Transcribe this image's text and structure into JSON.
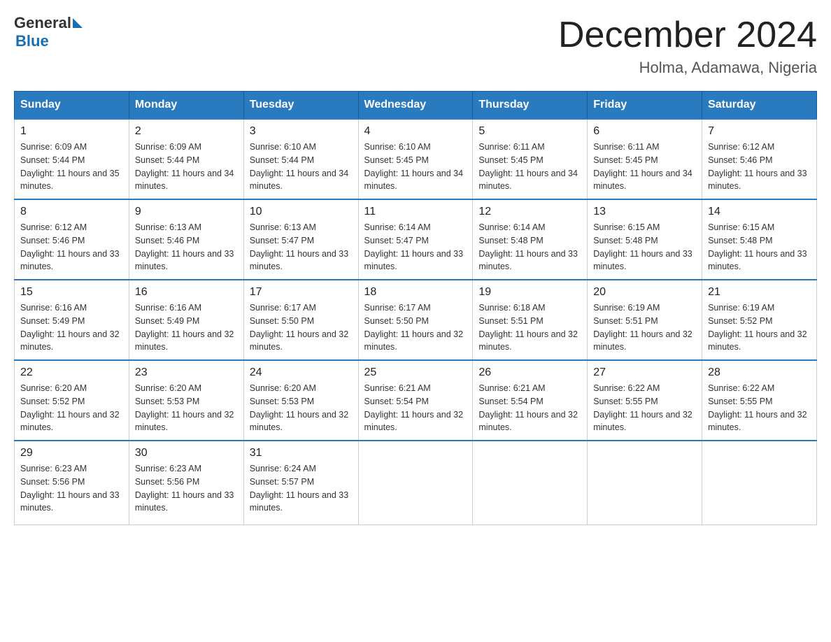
{
  "header": {
    "logo_text1": "General",
    "logo_text2": "Blue",
    "month_title": "December 2024",
    "location": "Holma, Adamawa, Nigeria"
  },
  "days_of_week": [
    "Sunday",
    "Monday",
    "Tuesday",
    "Wednesday",
    "Thursday",
    "Friday",
    "Saturday"
  ],
  "weeks": [
    [
      {
        "day": "1",
        "sunrise": "6:09 AM",
        "sunset": "5:44 PM",
        "daylight": "11 hours and 35 minutes."
      },
      {
        "day": "2",
        "sunrise": "6:09 AM",
        "sunset": "5:44 PM",
        "daylight": "11 hours and 34 minutes."
      },
      {
        "day": "3",
        "sunrise": "6:10 AM",
        "sunset": "5:44 PM",
        "daylight": "11 hours and 34 minutes."
      },
      {
        "day": "4",
        "sunrise": "6:10 AM",
        "sunset": "5:45 PM",
        "daylight": "11 hours and 34 minutes."
      },
      {
        "day": "5",
        "sunrise": "6:11 AM",
        "sunset": "5:45 PM",
        "daylight": "11 hours and 34 minutes."
      },
      {
        "day": "6",
        "sunrise": "6:11 AM",
        "sunset": "5:45 PM",
        "daylight": "11 hours and 34 minutes."
      },
      {
        "day": "7",
        "sunrise": "6:12 AM",
        "sunset": "5:46 PM",
        "daylight": "11 hours and 33 minutes."
      }
    ],
    [
      {
        "day": "8",
        "sunrise": "6:12 AM",
        "sunset": "5:46 PM",
        "daylight": "11 hours and 33 minutes."
      },
      {
        "day": "9",
        "sunrise": "6:13 AM",
        "sunset": "5:46 PM",
        "daylight": "11 hours and 33 minutes."
      },
      {
        "day": "10",
        "sunrise": "6:13 AM",
        "sunset": "5:47 PM",
        "daylight": "11 hours and 33 minutes."
      },
      {
        "day": "11",
        "sunrise": "6:14 AM",
        "sunset": "5:47 PM",
        "daylight": "11 hours and 33 minutes."
      },
      {
        "day": "12",
        "sunrise": "6:14 AM",
        "sunset": "5:48 PM",
        "daylight": "11 hours and 33 minutes."
      },
      {
        "day": "13",
        "sunrise": "6:15 AM",
        "sunset": "5:48 PM",
        "daylight": "11 hours and 33 minutes."
      },
      {
        "day": "14",
        "sunrise": "6:15 AM",
        "sunset": "5:48 PM",
        "daylight": "11 hours and 33 minutes."
      }
    ],
    [
      {
        "day": "15",
        "sunrise": "6:16 AM",
        "sunset": "5:49 PM",
        "daylight": "11 hours and 32 minutes."
      },
      {
        "day": "16",
        "sunrise": "6:16 AM",
        "sunset": "5:49 PM",
        "daylight": "11 hours and 32 minutes."
      },
      {
        "day": "17",
        "sunrise": "6:17 AM",
        "sunset": "5:50 PM",
        "daylight": "11 hours and 32 minutes."
      },
      {
        "day": "18",
        "sunrise": "6:17 AM",
        "sunset": "5:50 PM",
        "daylight": "11 hours and 32 minutes."
      },
      {
        "day": "19",
        "sunrise": "6:18 AM",
        "sunset": "5:51 PM",
        "daylight": "11 hours and 32 minutes."
      },
      {
        "day": "20",
        "sunrise": "6:19 AM",
        "sunset": "5:51 PM",
        "daylight": "11 hours and 32 minutes."
      },
      {
        "day": "21",
        "sunrise": "6:19 AM",
        "sunset": "5:52 PM",
        "daylight": "11 hours and 32 minutes."
      }
    ],
    [
      {
        "day": "22",
        "sunrise": "6:20 AM",
        "sunset": "5:52 PM",
        "daylight": "11 hours and 32 minutes."
      },
      {
        "day": "23",
        "sunrise": "6:20 AM",
        "sunset": "5:53 PM",
        "daylight": "11 hours and 32 minutes."
      },
      {
        "day": "24",
        "sunrise": "6:20 AM",
        "sunset": "5:53 PM",
        "daylight": "11 hours and 32 minutes."
      },
      {
        "day": "25",
        "sunrise": "6:21 AM",
        "sunset": "5:54 PM",
        "daylight": "11 hours and 32 minutes."
      },
      {
        "day": "26",
        "sunrise": "6:21 AM",
        "sunset": "5:54 PM",
        "daylight": "11 hours and 32 minutes."
      },
      {
        "day": "27",
        "sunrise": "6:22 AM",
        "sunset": "5:55 PM",
        "daylight": "11 hours and 32 minutes."
      },
      {
        "day": "28",
        "sunrise": "6:22 AM",
        "sunset": "5:55 PM",
        "daylight": "11 hours and 32 minutes."
      }
    ],
    [
      {
        "day": "29",
        "sunrise": "6:23 AM",
        "sunset": "5:56 PM",
        "daylight": "11 hours and 33 minutes."
      },
      {
        "day": "30",
        "sunrise": "6:23 AM",
        "sunset": "5:56 PM",
        "daylight": "11 hours and 33 minutes."
      },
      {
        "day": "31",
        "sunrise": "6:24 AM",
        "sunset": "5:57 PM",
        "daylight": "11 hours and 33 minutes."
      },
      null,
      null,
      null,
      null
    ]
  ]
}
